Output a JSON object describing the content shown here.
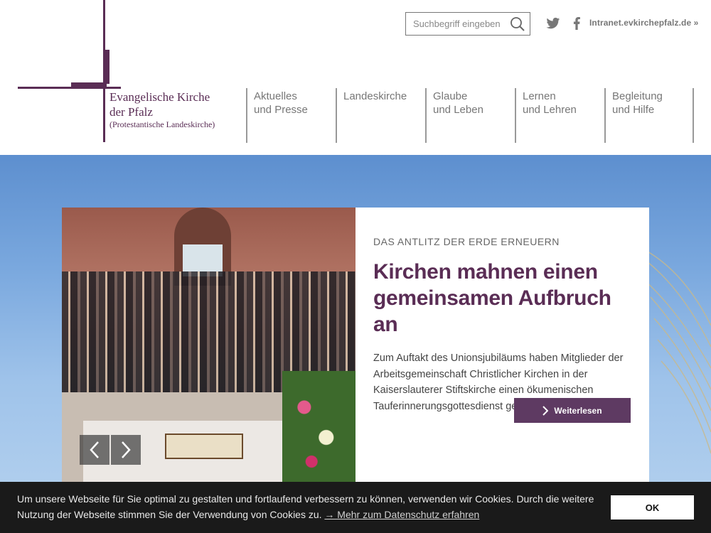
{
  "logo": {
    "line1": "Evangelische Kirche",
    "line2": "der Pfalz",
    "line3": "(Protestantische Landeskirche)"
  },
  "header": {
    "search_placeholder": "Suchbegriff eingeben",
    "intranet_link": "Intranet.evkirchepfalz.de »"
  },
  "nav": [
    {
      "line1": "Aktuelles",
      "line2": "und Presse"
    },
    {
      "line1": "Landeskirche",
      "line2": ""
    },
    {
      "line1": "Glaube",
      "line2": "und Leben"
    },
    {
      "line1": "Lernen",
      "line2": "und Lehren"
    },
    {
      "line1": "Begleitung",
      "line2": "und Hilfe"
    }
  ],
  "hero": {
    "kicker": "DAS ANTLITZ DER ERDE ERNEUERN",
    "headline": "Kirchen mahnen einen gemeinsamen Aufbruch an",
    "body": "Zum Auftakt des Unionsjubiläums haben Mitglieder der Arbeitsgemeinschaft Christlicher Kirchen in der Kaiserslauterer Stiftskirche einen ökumenischen Tauferinnerungsgottesdienst gefeiert.",
    "button_label": "Weiterlesen"
  },
  "cookie": {
    "text": "Um unsere Webseite für Sie optimal zu gestalten und fortlaufend verbessern zu können, verwenden wir Cookies. Durch die weitere Nutzung der Webseite stimmen Sie der Verwendung von Cookies zu.",
    "link": "→ Mehr zum Datenschutz erfahren",
    "ok_label": "OK"
  },
  "colors": {
    "brand": "#5a2d55",
    "button": "#5e3a62",
    "cookie_bg": "#1a1a1a"
  }
}
